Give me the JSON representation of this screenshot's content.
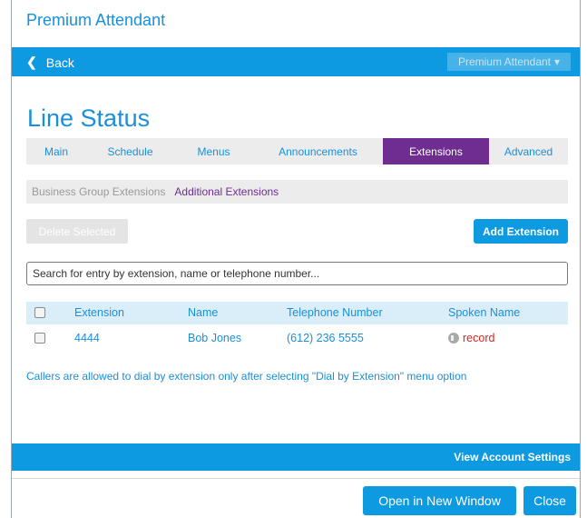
{
  "app": {
    "title": "Premium Attendant"
  },
  "topbar": {
    "back_label": "Back",
    "dropdown_label": "Premium Attendant"
  },
  "page": {
    "title": "Line Status"
  },
  "tabs": [
    {
      "label": "Main"
    },
    {
      "label": "Schedule"
    },
    {
      "label": "Menus"
    },
    {
      "label": "Announcements"
    },
    {
      "label": "Extensions",
      "active": true
    },
    {
      "label": "Advanced"
    }
  ],
  "subnav": {
    "item1": "Business Group Extensions",
    "item2": "Additional Extensions"
  },
  "actions": {
    "delete_label": "Delete Selected",
    "add_label": "Add Extension"
  },
  "search": {
    "placeholder": "Search for entry by extension, name or telephone number..."
  },
  "table": {
    "headers": [
      "Extension",
      "Name",
      "Telephone Number",
      "Spoken Name"
    ],
    "rows": [
      {
        "extension": "4444",
        "name": "Bob Jones",
        "telephone": "(612) 236 5555",
        "spoken": "record"
      }
    ]
  },
  "note": "Callers are allowed to dial by extension only after selecting \"Dial by Extension\" menu option",
  "footer": {
    "view_account": "View Account Settings",
    "open_window": "Open in New Window",
    "close": "Close"
  },
  "colors": {
    "primary": "#0d9ae0",
    "accent": "#6f2c91",
    "record": "#e02020",
    "header_bg": "#d9eef8"
  }
}
